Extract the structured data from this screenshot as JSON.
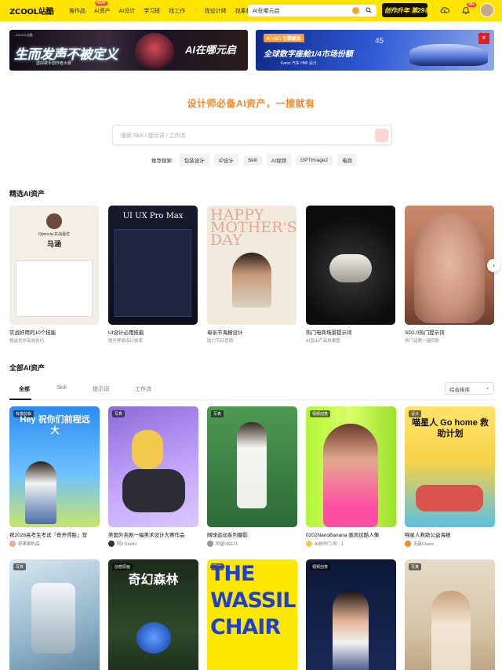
{
  "header": {
    "logo": "ZCOOL站酷",
    "nav": [
      "推作品",
      "AI资产",
      "AI设计",
      "学习班",
      "找工作",
      "·",
      "找设计师",
      "找素材"
    ],
    "new_badge": "NEW",
    "search_value": "AI在哪元启",
    "promo": "创作升年 第29季",
    "notif_count": "99+"
  },
  "banners": {
    "left": {
      "tag": "ZCOOL站酷",
      "title": "生而发声不被定义",
      "subtitle": "虚拟歌手创作者大赛",
      "right_text": "AI在哪元启"
    },
    "right": {
      "tag": "KANZI 引擎赋能",
      "number": "45",
      "title": "全球数字座舱1/4市场份额",
      "subtitle": "Kanzi 汽车 HMI 设计",
      "logo": "iF"
    }
  },
  "hero": {
    "title": "设计师必备AI资产，一搜就有",
    "search_placeholder": "搜索 Skill / 提示词 / 工作流",
    "hot_label": "推荐搜索:",
    "hot_tags": [
      "包装设计",
      "IP设计",
      "Skill",
      "AI视频",
      "GPTImage2",
      "电商"
    ]
  },
  "featured": {
    "title": "精选AI资产",
    "cards": [
      {
        "title": "实战好用的10个技能",
        "sub": "精选优作高效技巧",
        "img_text": "Opencla-实战最优",
        "img_name": "马涵"
      },
      {
        "title": "UI设计必用技能",
        "sub": "提升界面设计效率",
        "img_text": "UI UX Pro Max"
      },
      {
        "title": "母亲节海报设计",
        "sub": "助力节日营销",
        "img_text": "HAPPY MOTHER'S DAY"
      },
      {
        "title": "热门电商场景提示词",
        "sub": "AI直出产品效果图"
      },
      {
        "title": "SD2.0热门提示词",
        "sub": "热门话题一键同款"
      }
    ]
  },
  "all": {
    "title": "全部AI资产",
    "tabs": [
      "全部",
      "Skill",
      "提示词",
      "工作流"
    ],
    "sort": "综合排序"
  },
  "grid_row1": [
    {
      "badge": "有模剪辑",
      "title": "祝2026高考生考试「奇开得胜」营",
      "user": "奇果果的品",
      "overlay": "Hey 祝你们前程远大"
    },
    {
      "badge": "写真",
      "title": "美国外卖剧一幅美术设计大赛作品",
      "user": "阿ti Studio"
    },
    {
      "badge": "写真",
      "title": "网球运动系列摄影",
      "user": "阿星VKE21"
    },
    {
      "badge": "视频创意",
      "title": "0202NanoBanana 画风炫酷人像",
      "user": "AI创作门-所 · 1"
    },
    {
      "badge": "设计",
      "title": "喵星人救助公益海报",
      "user": "无敌Claws",
      "overlay": "喵星人 Go home 救助计划"
    }
  ],
  "grid_row2": [
    {
      "badge": "写真"
    },
    {
      "badge": "创意原画",
      "overlay": "奇幻森林"
    },
    {
      "badge": "写真",
      "overlay": "THE WASSIL CHAIR"
    },
    {
      "badge": "视频创意"
    },
    {
      "badge": "写真"
    }
  ]
}
